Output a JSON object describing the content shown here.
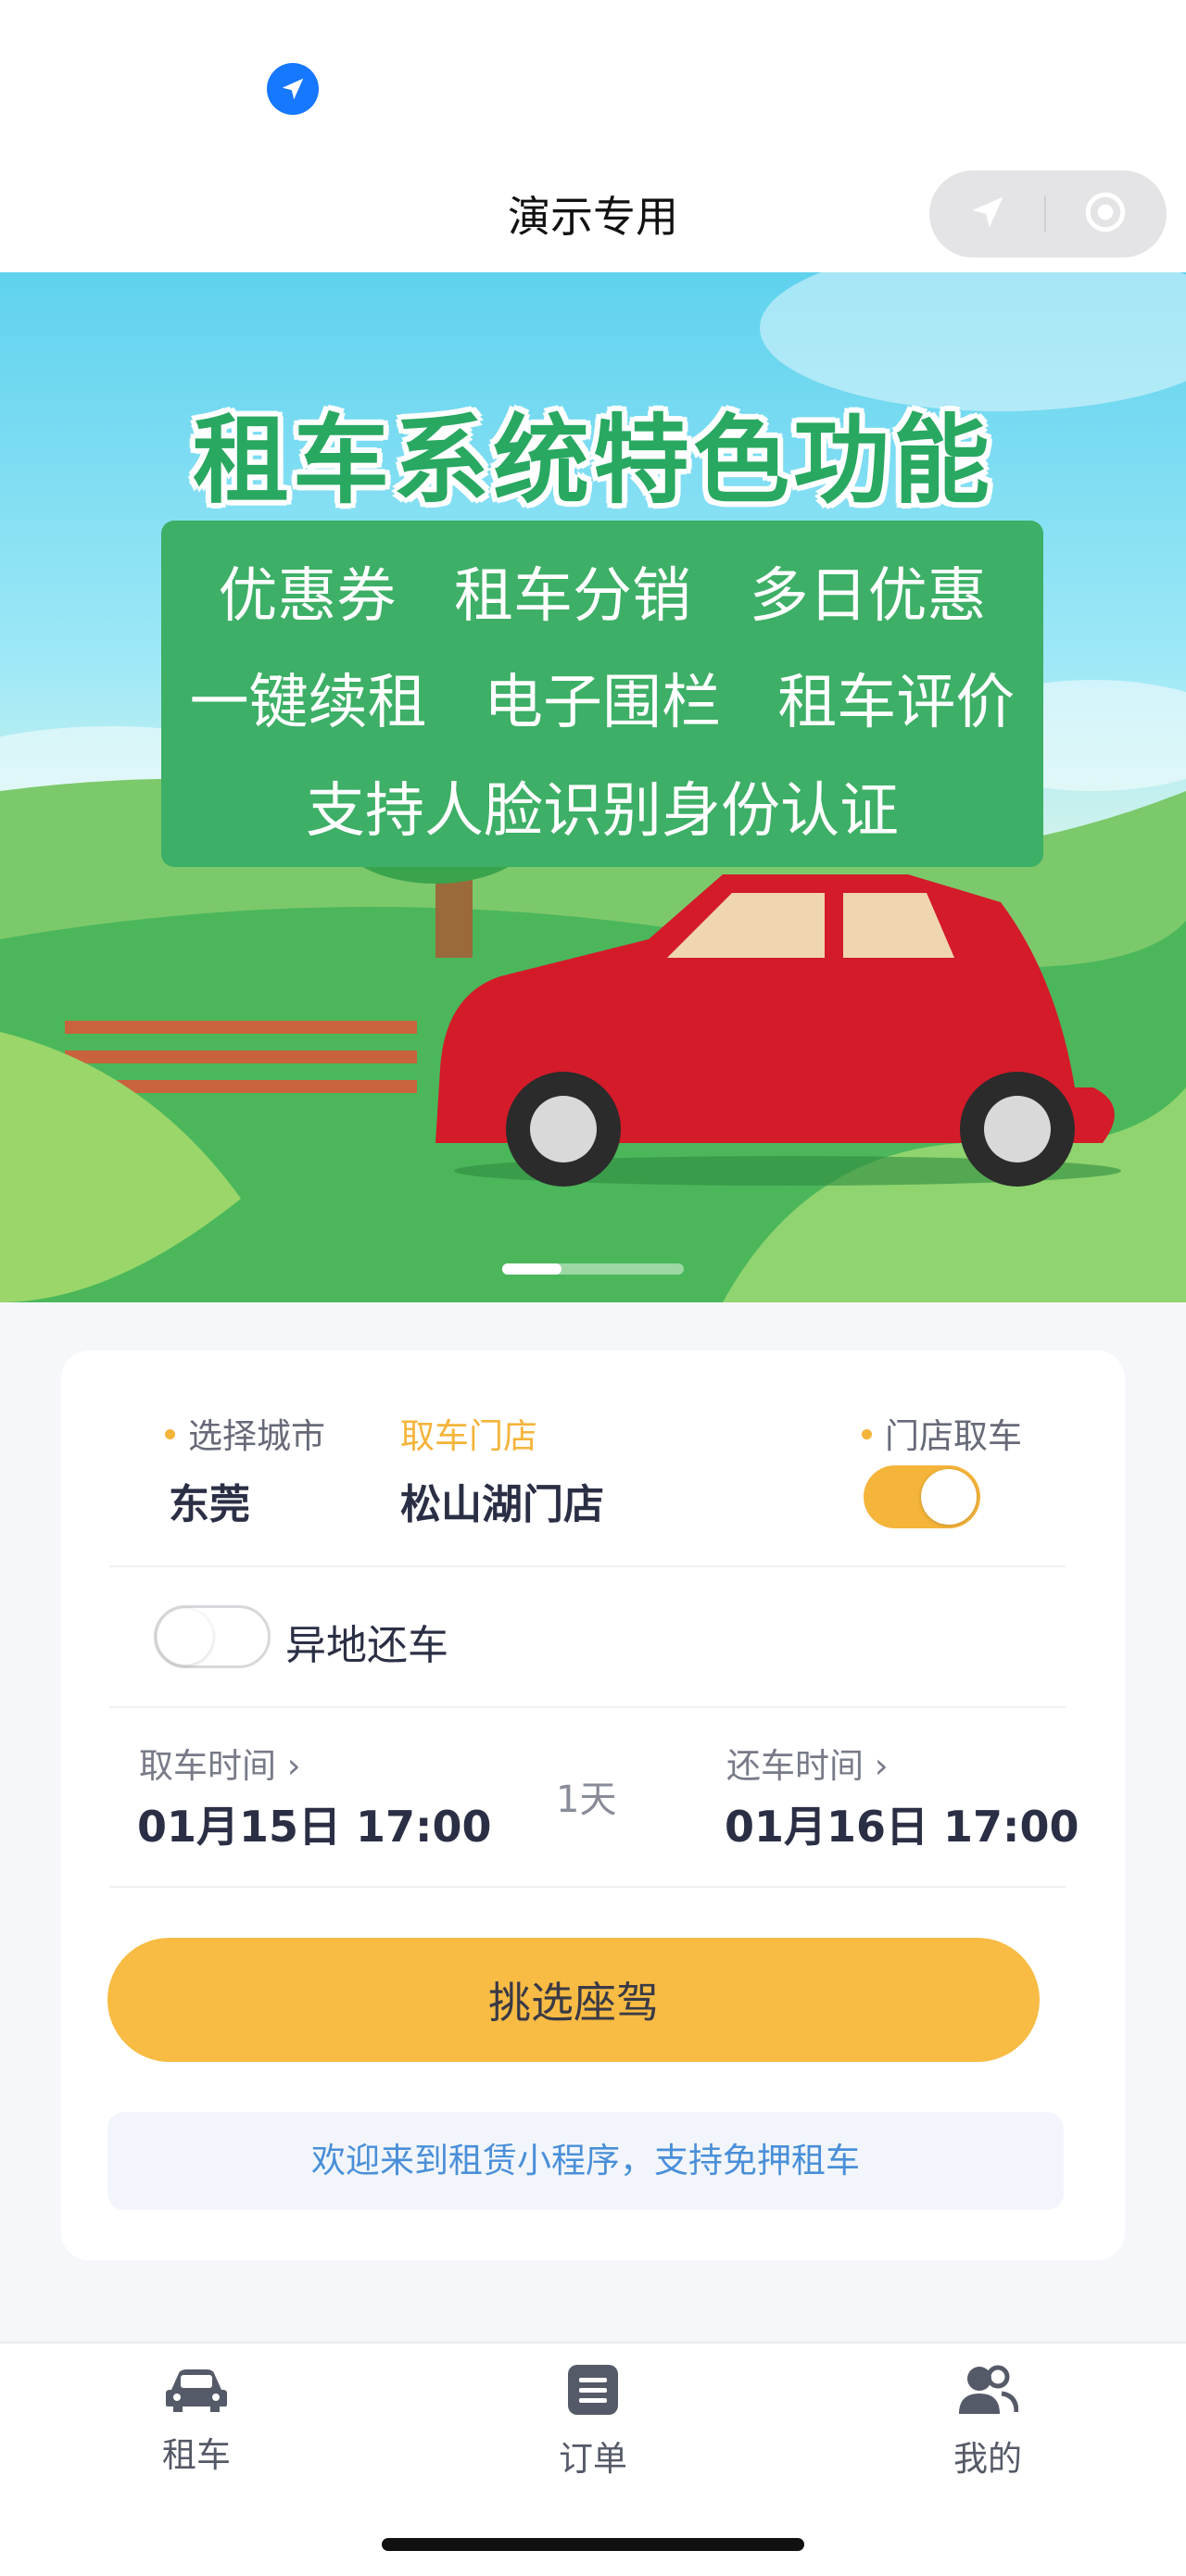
{
  "nav": {
    "title": "演示专用"
  },
  "banner": {
    "headline": "租车系统特色功能",
    "features_row1": [
      "优惠券",
      "租车分销",
      "多日优惠"
    ],
    "features_row2": [
      "一键续租",
      "电子围栏",
      "租车评价"
    ],
    "features_row3": "支持人脸识别身份认证"
  },
  "booking": {
    "city_label": "选择城市",
    "city_value": "东莞",
    "store_label": "取车门店",
    "store_value": "松山湖门店",
    "store_pickup_label": "门店取车",
    "store_pickup_on": true,
    "remote_return_label": "异地还车",
    "remote_return_on": false,
    "pickup_time_label": "取车时间",
    "pickup_time_value": "01月15日 17:00",
    "duration": "1天",
    "return_time_label": "还车时间",
    "return_time_value": "01月16日 17:00",
    "submit_label": "挑选座驾",
    "notice": "欢迎来到租赁小程序，支持免押租车"
  },
  "tabs": [
    {
      "label": "租车",
      "icon": "car-icon"
    },
    {
      "label": "订单",
      "icon": "orders-icon"
    },
    {
      "label": "我的",
      "icon": "profile-icon"
    }
  ],
  "colors": {
    "accent": "#f5b43a",
    "banner_green": "#3daf66",
    "link": "#4a8fd8"
  }
}
